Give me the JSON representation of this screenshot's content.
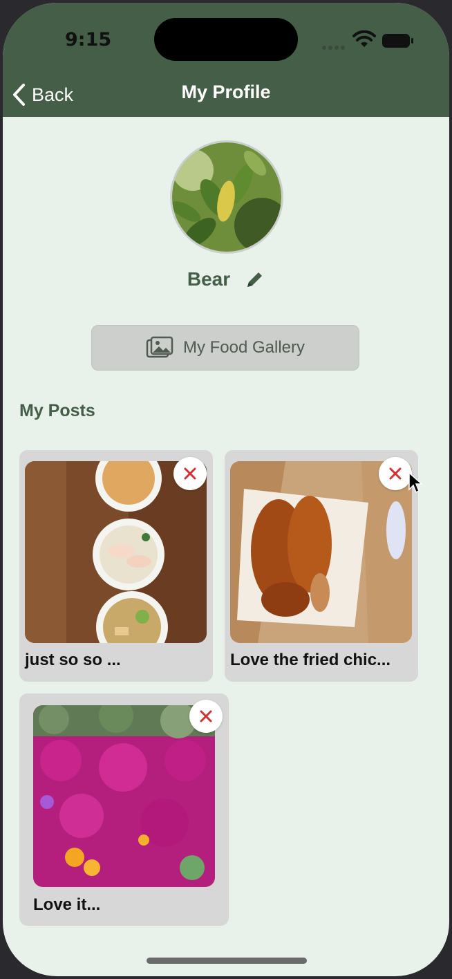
{
  "status": {
    "time": "9:15"
  },
  "nav": {
    "back_label": "Back",
    "title": "My Profile"
  },
  "profile": {
    "name": "Bear"
  },
  "gallery_button": {
    "label": "My Food Gallery"
  },
  "posts": {
    "title": "My Posts",
    "items": [
      {
        "caption": "just so so ..."
      },
      {
        "caption": "Love the fried chic..."
      },
      {
        "caption": "Love it..."
      }
    ]
  },
  "colors": {
    "header": "#445e47",
    "background": "#e8f1ea",
    "card": "#d7d7d7",
    "delete": "#d32f2f",
    "accent_text": "#445e47"
  }
}
